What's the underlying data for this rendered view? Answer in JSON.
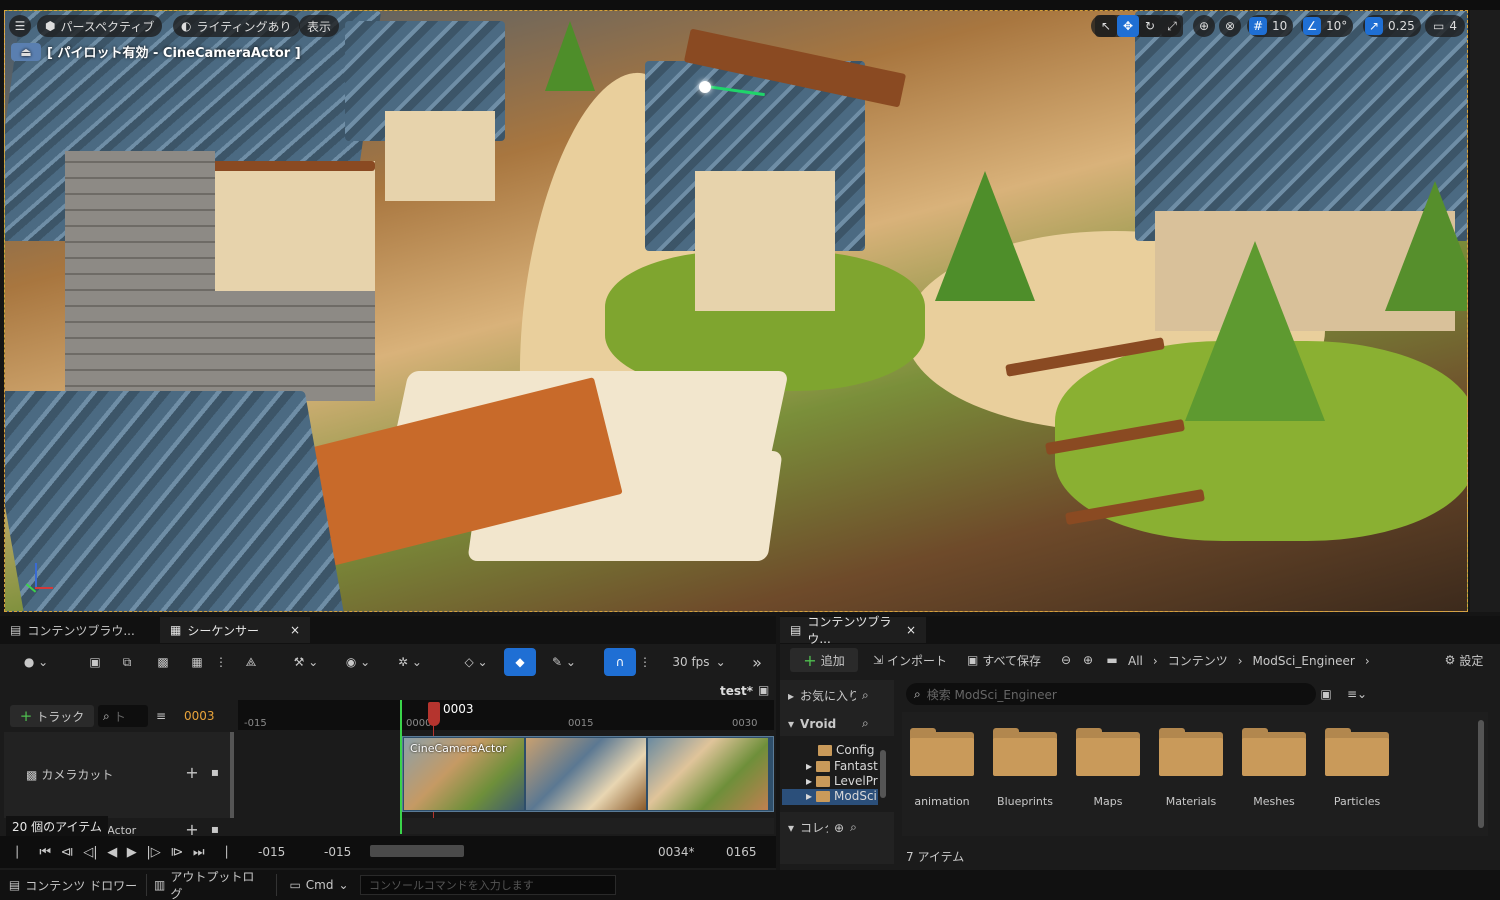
{
  "viewport": {
    "menu_icon": "hamburger-icon",
    "perspective": "パースペクティブ",
    "lighting": "ライティングあり",
    "show": "表示",
    "pilot_label": "[ パイロット有効 - CineCameraActor ]",
    "grid_snap": "10",
    "rotation_snap": "10°",
    "scale_snap": "0.25",
    "camera_speed": "4"
  },
  "sequencer_area": {
    "tabs": [
      {
        "label": "コンテンツブラウ..."
      },
      {
        "label": "シーケンサー",
        "close": "×"
      }
    ],
    "fps": "30 fps",
    "sequence_name": "test*",
    "add_track": "トラック",
    "search_placeholder": "ト",
    "current_frame": "0003",
    "playhead": "0003",
    "ticks": [
      "-015",
      "0000",
      "0015",
      "0030"
    ],
    "tracks": [
      {
        "label": "カメラカット"
      },
      {
        "label": "raActor"
      }
    ],
    "clip_label": "CineCameraActor",
    "item_count": "20 個のアイテム",
    "range": [
      "-015",
      "-015",
      "0034*",
      "0165"
    ]
  },
  "content_browser": {
    "tab_label": "コンテンツブラウ...",
    "tab_close": "×",
    "add": "追加",
    "import": "インポート",
    "save_all": "すべて保存",
    "breadcrumb": [
      "All",
      "コンテンツ",
      "ModSci_Engineer"
    ],
    "settings": "設定",
    "favorites": "お気に入り",
    "project": "Vroid",
    "collections": "コレクション",
    "search_placeholder": "検索 ModSci_Engineer",
    "tree": [
      "Config",
      "Fantast",
      "LevelPr",
      "ModSci"
    ],
    "folders": [
      "animation",
      "Blueprints",
      "Maps",
      "Materials",
      "Meshes",
      "Particles"
    ],
    "item_count": "7 アイテム"
  },
  "status_bar": {
    "content_drawer": "コンテンツ ドロワー",
    "output_log": "アウトプットログ",
    "cmd": "Cmd",
    "console_placeholder": "コンソールコマンドを入力します"
  },
  "colors": {
    "accent_blue": "#1f6fd4",
    "playhead_red": "#b5342e",
    "selection_orange": "#d8a33a",
    "folder": "#c99a5a"
  }
}
